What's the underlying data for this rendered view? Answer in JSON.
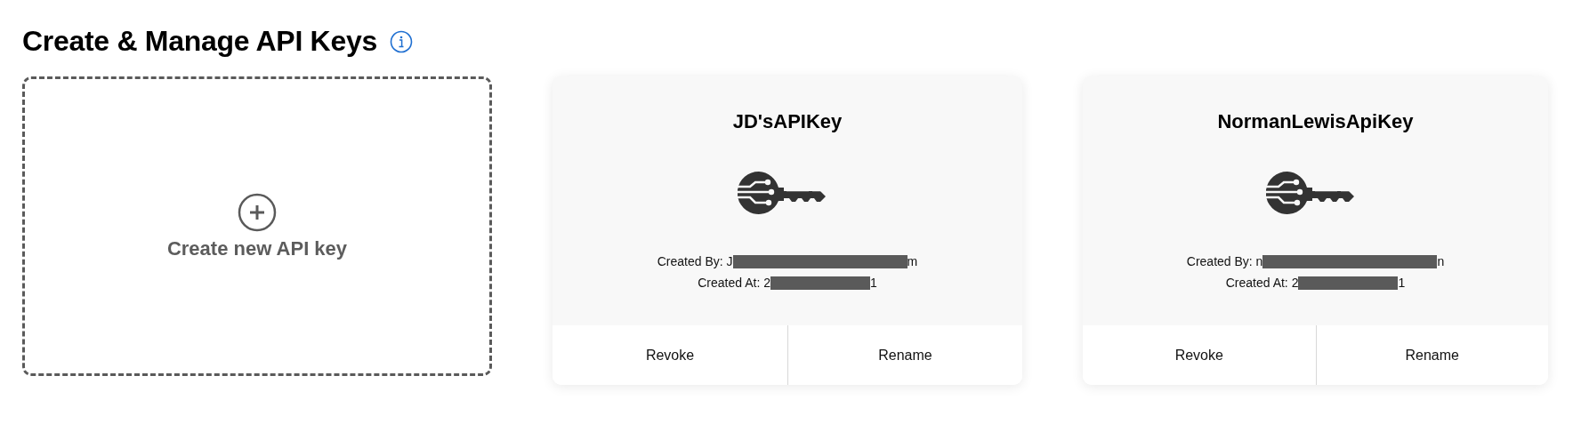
{
  "heading": {
    "title": "Create & Manage API Keys"
  },
  "create_tile": {
    "label": "Create new API key"
  },
  "api_keys": [
    {
      "name": "JD'sAPIKey",
      "created_by": {
        "label": "Created By:",
        "shown_start": "J",
        "shown_end": "m"
      },
      "created_at": {
        "label": "Created At:",
        "shown_start": "2",
        "shown_end": "1"
      },
      "actions": [
        "Revoke",
        "Rename"
      ]
    },
    {
      "name": "NormanLewisApiKey",
      "created_by": {
        "label": "Created By:",
        "shown_start": "n",
        "shown_end": "n"
      },
      "created_at": {
        "label": "Created At:",
        "shown_start": "2",
        "shown_end": "1"
      },
      "actions": [
        "Revoke",
        "Rename"
      ]
    }
  ]
}
